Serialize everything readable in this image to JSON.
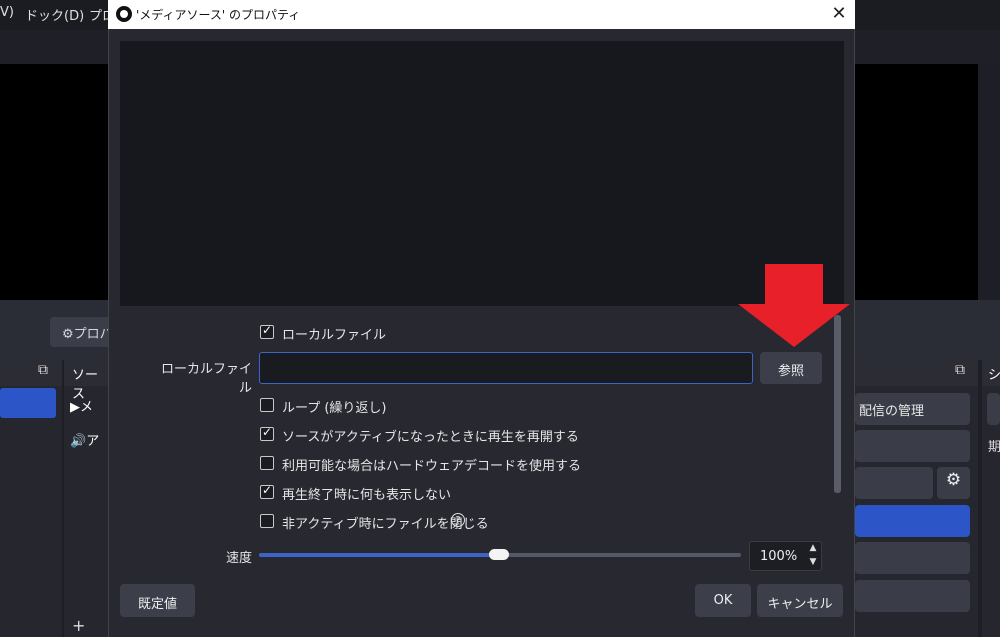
{
  "background": {
    "menu": [
      {
        "label": "V)"
      },
      {
        "label": "ドック(D)"
      },
      {
        "label": "プロ"
      }
    ],
    "properties_button_label": "プロパ",
    "scenes_dock_title": "",
    "sources_dock_title": "ソース",
    "sources": [
      "メ",
      "ア"
    ],
    "controls_dock_title": "シ",
    "controls": {
      "manage_broadcast": "配信の管理",
      "period_label": "期"
    }
  },
  "dialog": {
    "title": "'メディアソース' のプロパティ",
    "local_file_checkbox": {
      "label": "ローカルファイル",
      "checked": true
    },
    "local_file_field": {
      "label": "ローカルファイル",
      "value": ""
    },
    "browse_button": "参照",
    "options": [
      {
        "label": "ループ (繰り返し)",
        "checked": false
      },
      {
        "label": "ソースがアクティブになったときに再生を再開する",
        "checked": true
      },
      {
        "label": "利用可能な場合はハードウェアデコードを使用する",
        "checked": false
      },
      {
        "label": "再生終了時に何も表示しない",
        "checked": true
      },
      {
        "label": "非アクティブ時にファイルを閉じる",
        "checked": false
      }
    ],
    "speed": {
      "label": "速度",
      "value_text": "100%",
      "slider_fraction": 0.5
    },
    "buttons": {
      "defaults": "既定値",
      "ok": "OK",
      "cancel": "キャンセル"
    }
  },
  "colors": {
    "accent": "#3f64c7",
    "arrow": "#e8202a"
  },
  "icons": [
    "obs-logo-icon",
    "close-icon",
    "help-icon",
    "gear-icon",
    "down-arrow-annotation-icon"
  ]
}
